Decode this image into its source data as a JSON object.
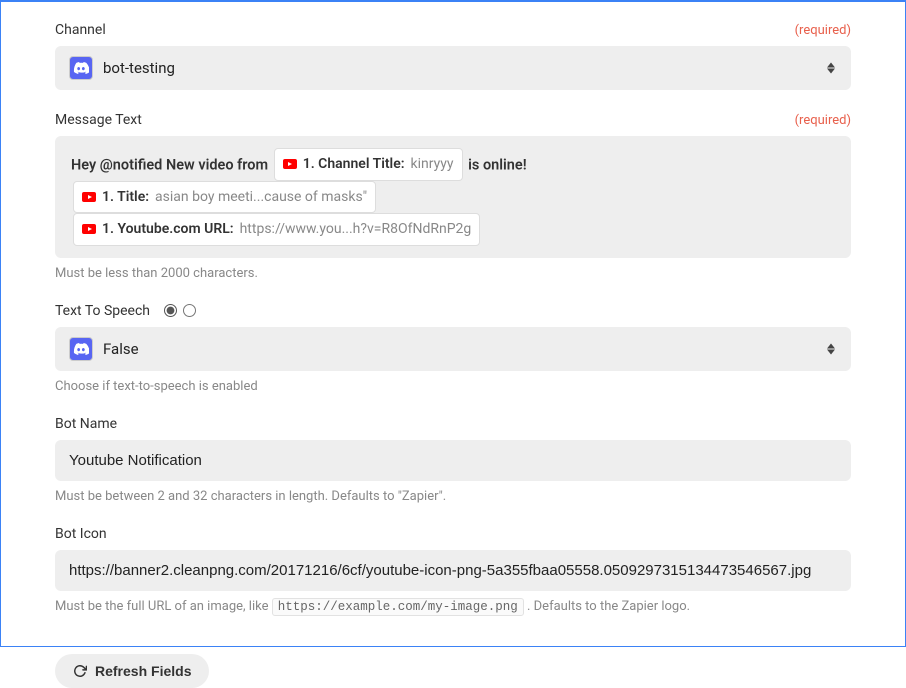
{
  "channel": {
    "label": "Channel",
    "required_text": "(required)",
    "value": "bot-testing"
  },
  "message": {
    "label": "Message Text",
    "required_text": "(required)",
    "prefix": "Hey @notified New video from",
    "pill1_label": "1. Channel Title:",
    "pill1_value": "kinryyy",
    "mid": "is online!",
    "pill2_label": "1. Title:",
    "pill2_value": "asian boy meeti...cause of masks\"",
    "pill3_label": "1. Youtube.com URL:",
    "pill3_value": "https://www.you...h?v=R8OfNdRnP2g",
    "help": "Must be less than 2000 characters."
  },
  "tts": {
    "label": "Text To Speech",
    "value": "False",
    "help": "Choose if text-to-speech is enabled"
  },
  "bot_name": {
    "label": "Bot Name",
    "value": "Youtube Notification",
    "help": "Must be between 2 and 32 characters in length. Defaults to \"Zapier\"."
  },
  "bot_icon": {
    "label": "Bot Icon",
    "value": "https://banner2.cleanpng.com/20171216/6cf/youtube-icon-png-5a355fbaa05558.0509297315134473546567.jpg",
    "help_prefix": "Must be the full URL of an image, like",
    "help_code": "https://example.com/my-image.png",
    "help_suffix": ". Defaults to the Zapier logo."
  },
  "refresh_label": "Refresh Fields"
}
